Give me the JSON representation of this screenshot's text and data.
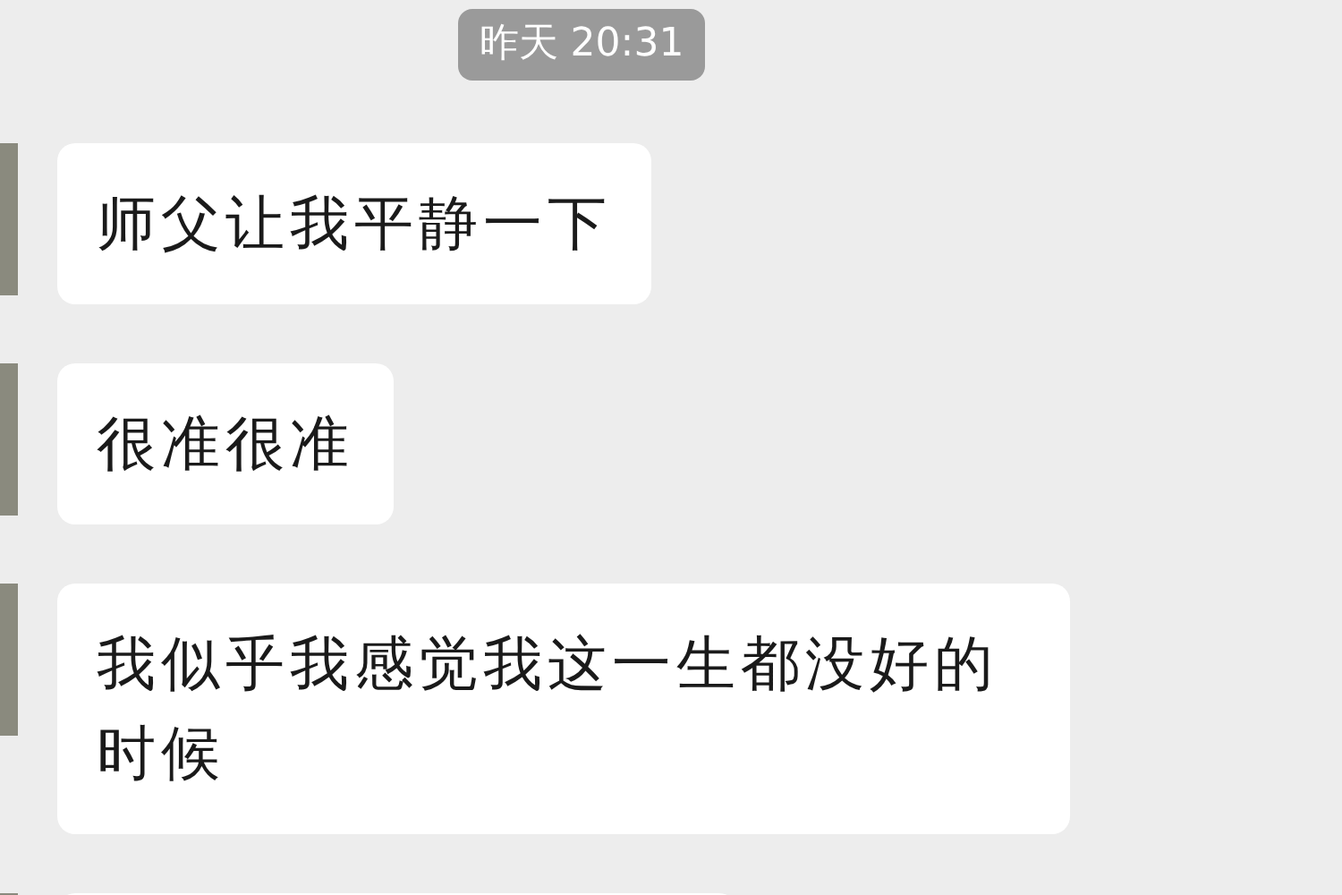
{
  "timestamp": "昨天 20:31",
  "messages": [
    {
      "kind": "text",
      "text": "师父让我平静一下"
    },
    {
      "kind": "text",
      "text": "很准很准"
    },
    {
      "kind": "text",
      "text": "我似乎我感觉我这一生都没好的时候"
    },
    {
      "kind": "cut"
    }
  ]
}
